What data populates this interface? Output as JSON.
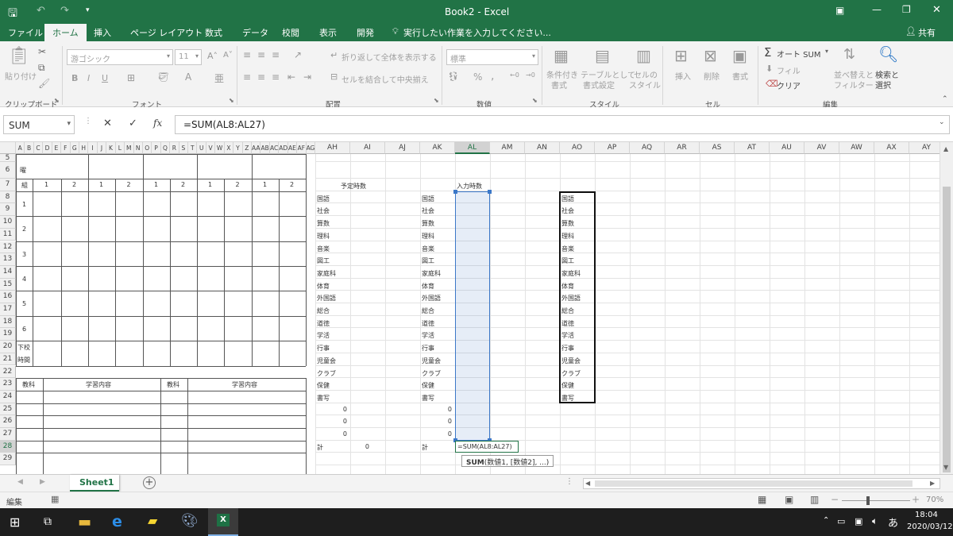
{
  "window": {
    "title": "Book2 - Excel"
  },
  "tabs": {
    "file": "ファイル",
    "home": "ホーム",
    "insert": "挿入",
    "layout": "ページ レイアウト",
    "formulas": "数式",
    "data": "データ",
    "review": "校閲",
    "view": "表示",
    "developer": "開発",
    "tellme": "実行したい作業を入力してください...",
    "share": "共有"
  },
  "ribbon": {
    "clipboard": {
      "paste": "貼り付け",
      "group": "クリップボード"
    },
    "font": {
      "name": "游ゴシック",
      "size": "11",
      "bold": "B",
      "italic": "I",
      "underline": "U",
      "group": "フォント"
    },
    "align": {
      "wrap": "折り返して全体を表示する",
      "merge": "セルを結合して中央揃え",
      "group": "配置"
    },
    "number": {
      "format": "標準",
      "percent": "%",
      "comma": ",",
      "group": "数値"
    },
    "styles": {
      "cond1": "条件付き",
      "cond2": "書式",
      "table1": "テーブルとして",
      "table2": "書式設定",
      "cell1": "セルの",
      "cell2": "スタイル",
      "group": "スタイル"
    },
    "cells": {
      "insert": "挿入",
      "delete": "削除",
      "format": "書式",
      "group": "セル"
    },
    "edit": {
      "autosum": "オート SUM",
      "fill": "フィル",
      "clear": "クリア",
      "sort1": "並べ替えと",
      "sort2": "フィルター",
      "find1": "検索と",
      "find2": "選択",
      "group": "編集"
    }
  },
  "formula": {
    "namebox": "SUM",
    "fx": "fx",
    "cancel": "✕",
    "enter": "✓",
    "content": "=SUM(AL8:AL27)"
  },
  "columns": {
    "small": [
      "A",
      "B",
      "C",
      "D",
      "E",
      "F",
      "G",
      "H",
      "I",
      "J",
      "K",
      "L",
      "M",
      "N",
      "O",
      "P",
      "Q",
      "R",
      "S",
      "T",
      "U",
      "V",
      "W",
      "X",
      "Y",
      "Z",
      "AA",
      "AB",
      "AC",
      "AD",
      "AE",
      "AF",
      "AG"
    ],
    "big": [
      "AH",
      "AI",
      "AJ",
      "AK",
      "AL",
      "AM",
      "AN",
      "AO",
      "AP",
      "AQ",
      "AR",
      "AS",
      "AT",
      "AU",
      "AV",
      "AW",
      "AX",
      "AY"
    ]
  },
  "rows": [
    "5",
    "6",
    "7",
    "8",
    "9",
    "10",
    "11",
    "12",
    "13",
    "14",
    "15",
    "16",
    "17",
    "18",
    "19",
    "20",
    "21",
    "22",
    "23",
    "24",
    "25",
    "26",
    "27",
    "28",
    "29"
  ],
  "sheet": {
    "hdr6": "曜",
    "kumi": "組",
    "kumi_nums": [
      "1",
      "2",
      "1",
      "2",
      "1",
      "2",
      "1",
      "2",
      "1",
      "2"
    ],
    "periods": [
      "1",
      "2",
      "3",
      "4",
      "5",
      "6"
    ],
    "gekou1": "下校",
    "gekou2": "時間",
    "kyoka": "教科",
    "naiyou": "学習内容",
    "yotei_header": "予定時数",
    "nyuryoku_header": "入力時数",
    "subjects": [
      "国語",
      "社会",
      "算数",
      "理科",
      "音楽",
      "図工",
      "家庭科",
      "体育",
      "外国語",
      "総合",
      "道徳",
      "学活",
      "行事",
      "児童会",
      "クラブ",
      "保健",
      "書写"
    ],
    "zeros": [
      "0",
      "0",
      "0"
    ],
    "total_label": "計",
    "total_val": "0",
    "formula_cell": "=SUM(AL8:AL27)",
    "tooltip_fn": "SUM",
    "tooltip_args": "(数値1, [数値2], ...)"
  },
  "sheettab": {
    "name": "Sheet1",
    "add": "+"
  },
  "status": {
    "mode": "編集",
    "zoom": "70%"
  },
  "taskbar": {
    "time": "18:04",
    "date": "2020/03/12",
    "ime": "あ"
  }
}
